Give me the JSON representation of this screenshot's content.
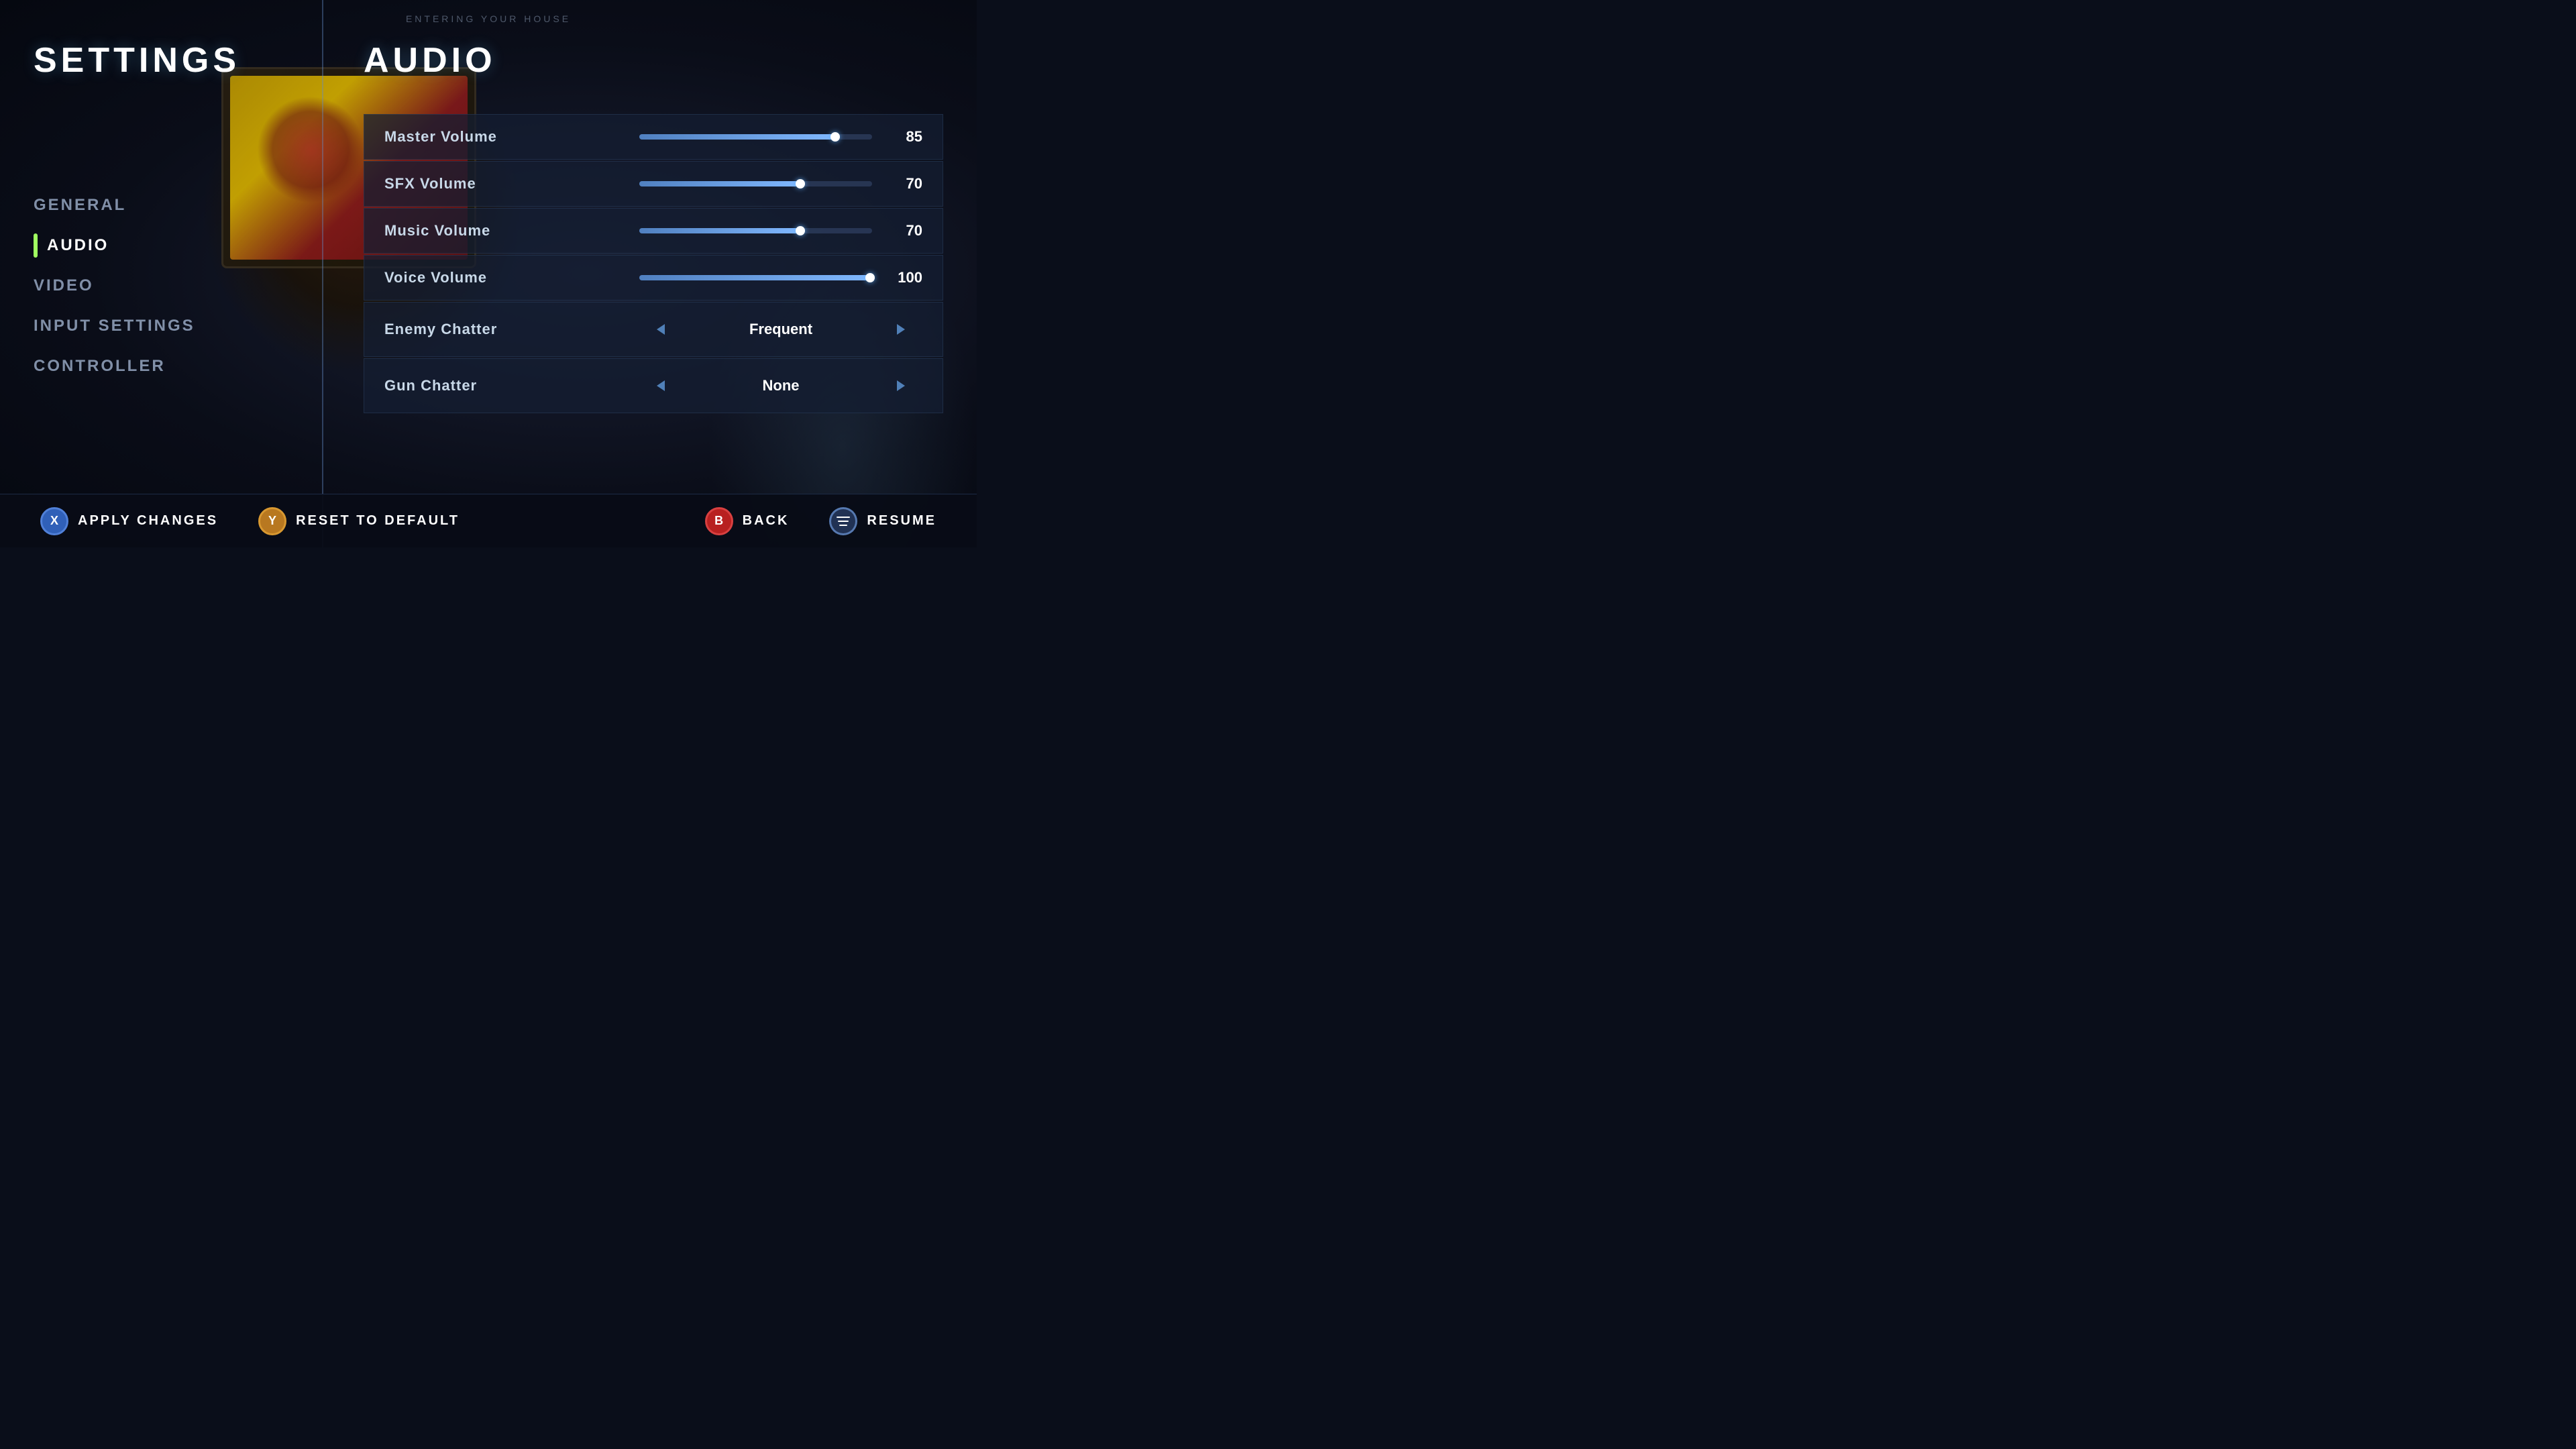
{
  "app": {
    "subtitle": "ENTERING YOUR HOUSE"
  },
  "sidebar": {
    "title": "SETTINGS",
    "nav_items": [
      {
        "id": "general",
        "label": "GENERAL",
        "active": false
      },
      {
        "id": "audio",
        "label": "AUDIO",
        "active": true
      },
      {
        "id": "video",
        "label": "VIDEO",
        "active": false
      },
      {
        "id": "input_settings",
        "label": "INPUT SETTINGS",
        "active": false
      },
      {
        "id": "controller",
        "label": "CONTROLLER",
        "active": false
      }
    ]
  },
  "main": {
    "section_title": "AUDIO",
    "settings": [
      {
        "id": "master_volume",
        "label": "Master Volume",
        "type": "slider",
        "value": 85,
        "fill_pct": 85
      },
      {
        "id": "sfx_volume",
        "label": "SFX Volume",
        "type": "slider",
        "value": 70,
        "fill_pct": 70
      },
      {
        "id": "music_volume",
        "label": "Music Volume",
        "type": "slider",
        "value": 70,
        "fill_pct": 70
      },
      {
        "id": "voice_volume",
        "label": "Voice Volume",
        "type": "slider",
        "value": 100,
        "fill_pct": 100
      },
      {
        "id": "enemy_chatter",
        "label": "Enemy Chatter",
        "type": "selector",
        "value": "Frequent"
      },
      {
        "id": "gun_chatter",
        "label": "Gun Chatter",
        "type": "selector",
        "value": "None"
      }
    ]
  },
  "toolbar": {
    "apply_label": "APPLY CHANGES",
    "reset_label": "RESET TO DEFAULT",
    "back_label": "BACK",
    "resume_label": "RESUME",
    "apply_icon": "X",
    "reset_icon": "Y",
    "back_icon": "B",
    "resume_icon": "menu"
  }
}
